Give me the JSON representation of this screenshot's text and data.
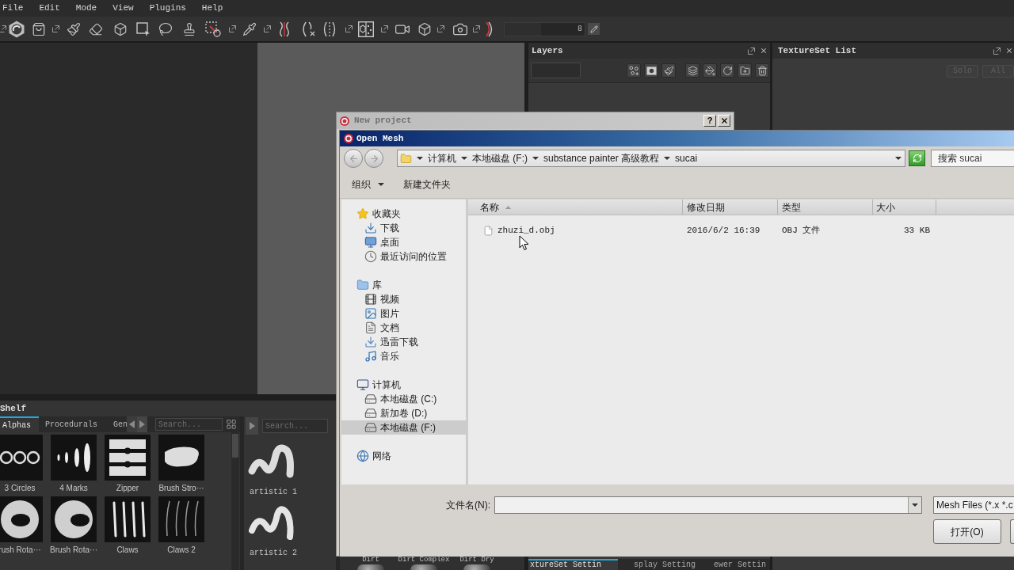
{
  "menu_bar": [
    "File",
    "Edit",
    "Mode",
    "View",
    "Plugins",
    "Help"
  ],
  "toolbar": {
    "brush_size": "8"
  },
  "shelf": {
    "title": "Shelf",
    "tabs": [
      {
        "label": "Alphas",
        "selected": true
      },
      {
        "label": "Procedurals",
        "selected": false
      },
      {
        "label": "Gen",
        "selected": false
      }
    ],
    "search": {
      "placeholder": "Search..."
    },
    "alphas": [
      {
        "label": "3 Circles"
      },
      {
        "label": "4 Marks"
      },
      {
        "label": "Zipper"
      },
      {
        "label": "Brush Stro···"
      },
      {
        "label": "rush Rota···"
      },
      {
        "label": "Brush Rota···"
      },
      {
        "label": "Claws"
      },
      {
        "label": "Claws 2"
      }
    ],
    "brushes": {
      "search": {
        "placeholder": "Search..."
      },
      "items": [
        {
          "label": "artistic 1"
        },
        {
          "label": "artistic 2"
        }
      ]
    },
    "materials": [
      {
        "label": "Dirt"
      },
      {
        "label": "Dirt Complex"
      },
      {
        "label": "Dirt Dry"
      }
    ]
  },
  "layers_panel": {
    "title": "Layers",
    "bottom_tabs": [
      {
        "label": "xtureSet Settin",
        "selected": true
      },
      {
        "label": "splay Setting",
        "selected": false
      },
      {
        "label": "ewer Settin",
        "selected": false
      }
    ]
  },
  "textureset_list": {
    "title": "TextureSet List",
    "buttons": [
      {
        "label": "Solo",
        "disabled": true
      },
      {
        "label": "All",
        "disabled": true
      }
    ]
  },
  "new_project_dialog": {
    "title": "New project",
    "help_button": "?"
  },
  "open_mesh_dialog": {
    "title": "Open Mesh",
    "breadcrumb": [
      "计算机",
      "本地磁盘 (F:)",
      "substance painter 高级教程",
      "sucai"
    ],
    "search": {
      "placeholder": "搜索 sucai"
    },
    "commands": [
      {
        "label": "组织",
        "kind": "menu"
      },
      {
        "label": "新建文件夹",
        "kind": "button"
      }
    ],
    "nav_tree": [
      {
        "label": "收藏夹",
        "selected": false,
        "children": [
          {
            "label": "下载",
            "selected": false
          },
          {
            "label": "桌面",
            "selected": false
          },
          {
            "label": "最近访问的位置",
            "selected": false
          }
        ]
      },
      {
        "label": "库",
        "selected": false,
        "children": [
          {
            "label": "视频",
            "selected": false
          },
          {
            "label": "图片",
            "selected": false
          },
          {
            "label": "文档",
            "selected": false
          },
          {
            "label": "迅雷下载",
            "selected": false
          },
          {
            "label": "音乐",
            "selected": false
          }
        ]
      },
      {
        "label": "计算机",
        "selected": false,
        "children": [
          {
            "label": "本地磁盘 (C:)",
            "selected": false
          },
          {
            "label": "新加卷 (D:)",
            "selected": false
          },
          {
            "label": "本地磁盘 (F:)",
            "selected": true
          }
        ]
      },
      {
        "label": "网络",
        "selected": false
      }
    ],
    "columns": [
      {
        "label": "名称",
        "sorted": true
      },
      {
        "label": "修改日期",
        "sorted": false
      },
      {
        "label": "类型",
        "sorted": false
      },
      {
        "label": "大小",
        "sorted": false
      }
    ],
    "files": [
      {
        "name": "zhuzi_d.obj",
        "modified": "2016/6/2 16:39",
        "type": "OBJ 文件",
        "size": "33 KB",
        "selected": false
      }
    ],
    "filename_label": "文件名(N):",
    "file_type": "Mesh Files (*.x *.c",
    "open_button": "打开(O)"
  }
}
